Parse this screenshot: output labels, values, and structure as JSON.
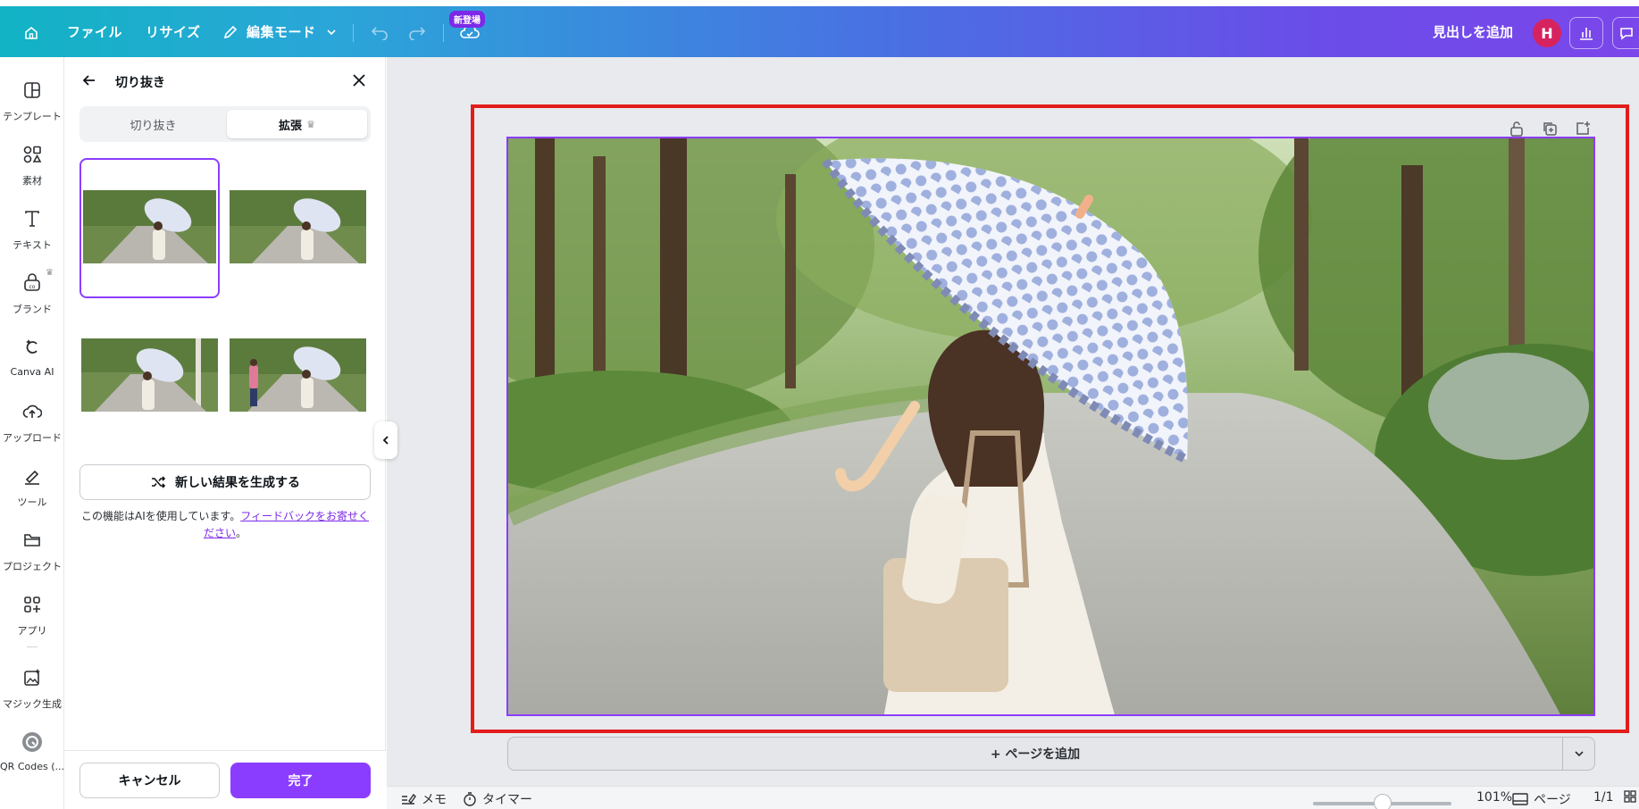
{
  "topbar": {
    "menu_file": "ファイル",
    "menu_resize": "リサイズ",
    "edit_mode": "編集モード",
    "new_badge": "新登場",
    "add_heading": "見出しを追加",
    "avatar_initial": "H"
  },
  "rail": {
    "items": [
      {
        "label": "テンプレート",
        "icon": "template-icon"
      },
      {
        "label": "素材",
        "icon": "elements-icon"
      },
      {
        "label": "テキスト",
        "icon": "text-icon"
      },
      {
        "label": "ブランド",
        "icon": "brand-icon"
      },
      {
        "label": "Canva AI",
        "icon": "canva-ai-icon"
      },
      {
        "label": "アップロード",
        "icon": "upload-icon"
      },
      {
        "label": "ツール",
        "icon": "tools-icon"
      },
      {
        "label": "プロジェクト",
        "icon": "projects-icon"
      },
      {
        "label": "アプリ",
        "icon": "apps-icon"
      },
      {
        "label": "マジック生成",
        "icon": "magic-generate-icon"
      },
      {
        "label": "QR Codes (...",
        "icon": "qr-codes-icon"
      }
    ]
  },
  "panel": {
    "title": "切り抜き",
    "tab_crop": "切り抜き",
    "tab_expand": "拡張",
    "generate_button": "新しい結果を生成する",
    "notice_text": "この機能はAIを使用しています。",
    "notice_link": "フィードバックをお寄せください",
    "notice_end": "。",
    "cancel_button": "キャンセル",
    "done_button": "完了"
  },
  "canvas": {
    "add_page": "+ ページを追加"
  },
  "bottombar": {
    "notes": "メモ",
    "timer": "タイマー",
    "zoom": "101%",
    "zoom_level": 0.5,
    "pages_label": "ページ",
    "page_count": "1/1"
  },
  "colors": {
    "accent": "#8b3dff",
    "highlight_frame": "#e31c1c"
  }
}
